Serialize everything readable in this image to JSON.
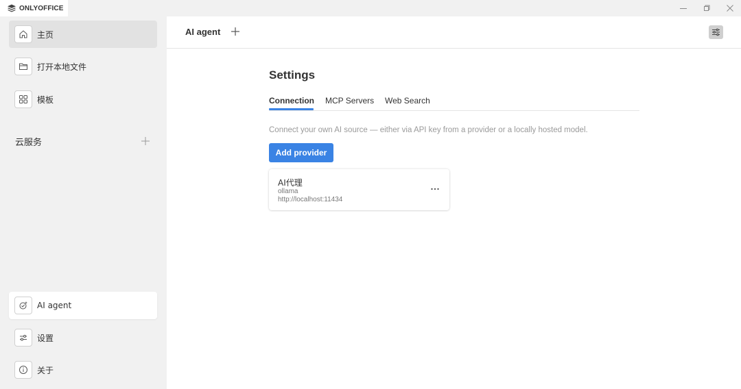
{
  "app": {
    "name": "ONLYOFFICE"
  },
  "sidebar": {
    "items": [
      {
        "label": "主页",
        "icon": "home-icon"
      },
      {
        "label": "打开本地文件",
        "icon": "folder-icon"
      },
      {
        "label": "模板",
        "icon": "templates-icon"
      }
    ],
    "cloud_label": "云服务",
    "bottom_items": [
      {
        "label": "AI agent",
        "icon": "ai-agent-icon"
      },
      {
        "label": "设置",
        "icon": "settings-sliders-icon"
      },
      {
        "label": "关于",
        "icon": "info-icon"
      }
    ]
  },
  "header": {
    "tab_title": "AI agent"
  },
  "settings": {
    "title": "Settings",
    "tabs": [
      {
        "label": "Connection",
        "active": true
      },
      {
        "label": "MCP Servers",
        "active": false
      },
      {
        "label": "Web Search",
        "active": false
      }
    ],
    "description": "Connect your own AI source — either via API key from a provider or a locally hosted model.",
    "add_provider_label": "Add provider",
    "providers": [
      {
        "name": "AI代理",
        "type": "ollama",
        "url": "http://localhost:11434"
      }
    ]
  },
  "colors": {
    "accent": "#3a83e4",
    "sidebar_bg": "#f1f1f1"
  }
}
